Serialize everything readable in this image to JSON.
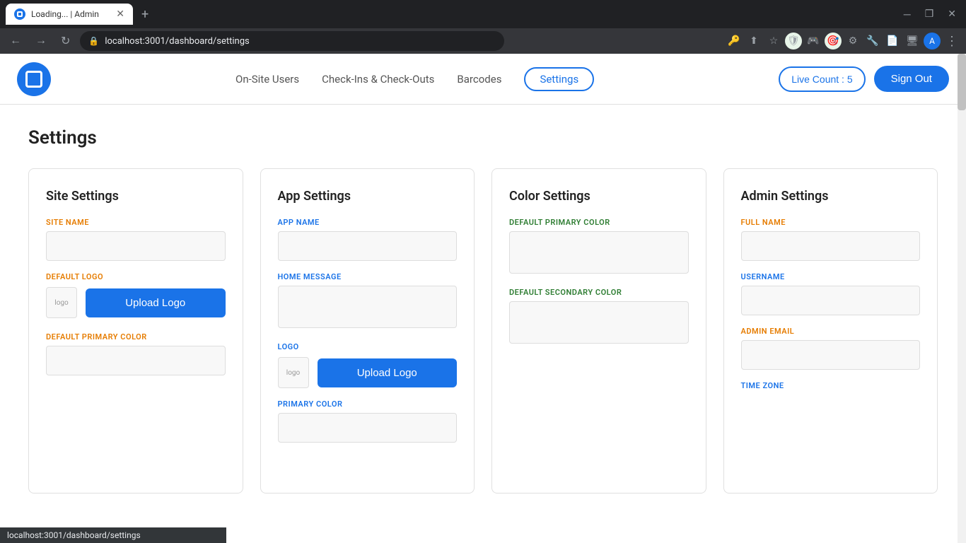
{
  "browser": {
    "tab_title": "Loading... | Admin",
    "url": "localhost:3001/dashboard/settings",
    "new_tab_label": "+",
    "window_minimize": "─",
    "window_maximize": "❒",
    "window_close": "✕"
  },
  "navbar": {
    "logo_alt": "logo",
    "nav_items": [
      {
        "id": "on-site-users",
        "label": "On-Site Users",
        "active": false
      },
      {
        "id": "check-ins",
        "label": "Check-Ins & Check-Outs",
        "active": false
      },
      {
        "id": "barcodes",
        "label": "Barcodes",
        "active": false
      },
      {
        "id": "settings",
        "label": "Settings",
        "active": true
      }
    ],
    "live_count_label": "Live Count : 5",
    "sign_out_label": "Sign Out"
  },
  "page": {
    "title": "Settings"
  },
  "settings_cards": [
    {
      "id": "site-settings",
      "title": "Site Settings",
      "fields": [
        {
          "id": "site-name",
          "label": "SITE NAME",
          "type": "text",
          "label_color": "orange"
        },
        {
          "id": "default-logo",
          "label": "DEFAULT LOGO",
          "type": "logo_upload",
          "label_color": "orange",
          "button_label": "Upload Logo"
        },
        {
          "id": "default-primary-color",
          "label": "DEFAULT PRIMARY COLOR",
          "type": "color",
          "label_color": "orange"
        }
      ]
    },
    {
      "id": "app-settings",
      "title": "App Settings",
      "fields": [
        {
          "id": "app-name",
          "label": "APP NAME",
          "type": "text",
          "label_color": "blue"
        },
        {
          "id": "home-message",
          "label": "HOME MESSAGE",
          "type": "textarea",
          "label_color": "blue"
        },
        {
          "id": "app-logo",
          "label": "LOGO",
          "type": "logo_upload",
          "label_color": "blue",
          "button_label": "Upload Logo"
        },
        {
          "id": "primary-color",
          "label": "PRIMARY COLOR",
          "type": "color",
          "label_color": "blue"
        }
      ]
    },
    {
      "id": "color-settings",
      "title": "Color Settings",
      "fields": [
        {
          "id": "default-primary-color-2",
          "label": "DEFAULT PRIMARY COLOR",
          "type": "color",
          "label_color": "green"
        },
        {
          "id": "default-secondary-color",
          "label": "DEFAULT SECONDARY COLOR",
          "type": "color",
          "label_color": "green"
        }
      ]
    },
    {
      "id": "admin-settings",
      "title": "Admin Settings",
      "fields": [
        {
          "id": "full-name",
          "label": "FULL NAME",
          "type": "text",
          "label_color": "orange"
        },
        {
          "id": "username",
          "label": "USERNAME",
          "type": "text",
          "label_color": "blue"
        },
        {
          "id": "admin-email",
          "label": "ADMIN EMAIL",
          "type": "text",
          "label_color": "orange"
        },
        {
          "id": "time-zone",
          "label": "TIME ZONE",
          "type": "text",
          "label_color": "blue"
        }
      ]
    }
  ],
  "status_bar": {
    "url": "localhost:3001/dashboard/settings"
  }
}
